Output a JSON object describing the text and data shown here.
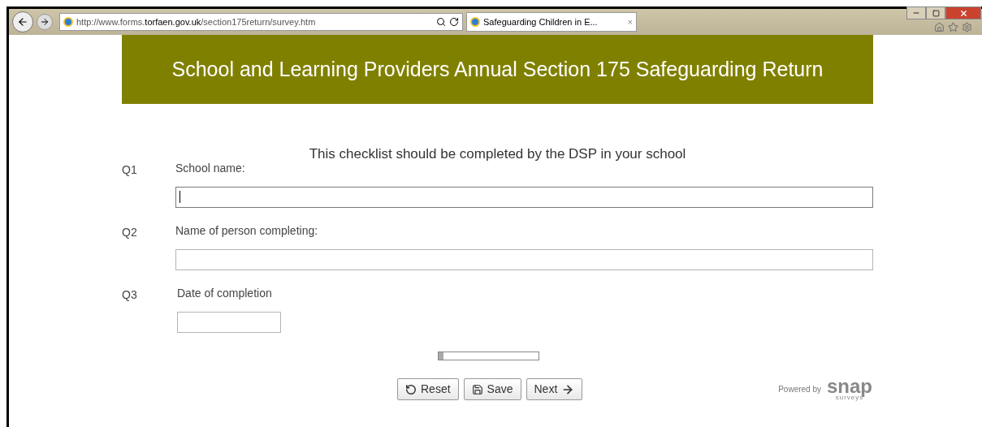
{
  "browser": {
    "url_prefix": "http://www.forms.",
    "url_domain": "torfaen.gov.uk",
    "url_path": "/section175return/survey.htm",
    "tab": {
      "label": "Safeguarding Children in E...",
      "close": "×"
    }
  },
  "form": {
    "title": "School and Learning Providers Annual Section 175 Safeguarding Return",
    "subtitle": "This checklist should be completed by the DSP in your school",
    "questions": [
      {
        "number": "Q1",
        "label": "School name:",
        "kind": "wide",
        "focused": true
      },
      {
        "number": "Q2",
        "label": "Name of person completing:",
        "kind": "wide",
        "focused": false
      },
      {
        "number": "Q3",
        "label": "Date of completion",
        "kind": "short",
        "focused": false
      }
    ],
    "progress": {
      "level": 0.05
    },
    "buttons": [
      {
        "label": "Reset",
        "kind": "reset"
      },
      {
        "label": "Save",
        "kind": "save"
      },
      {
        "label": "Next",
        "kind": "next"
      }
    ],
    "powered_by": {
      "label": "Powered by",
      "logo": "snap",
      "logo_sub": "surveys"
    }
  }
}
